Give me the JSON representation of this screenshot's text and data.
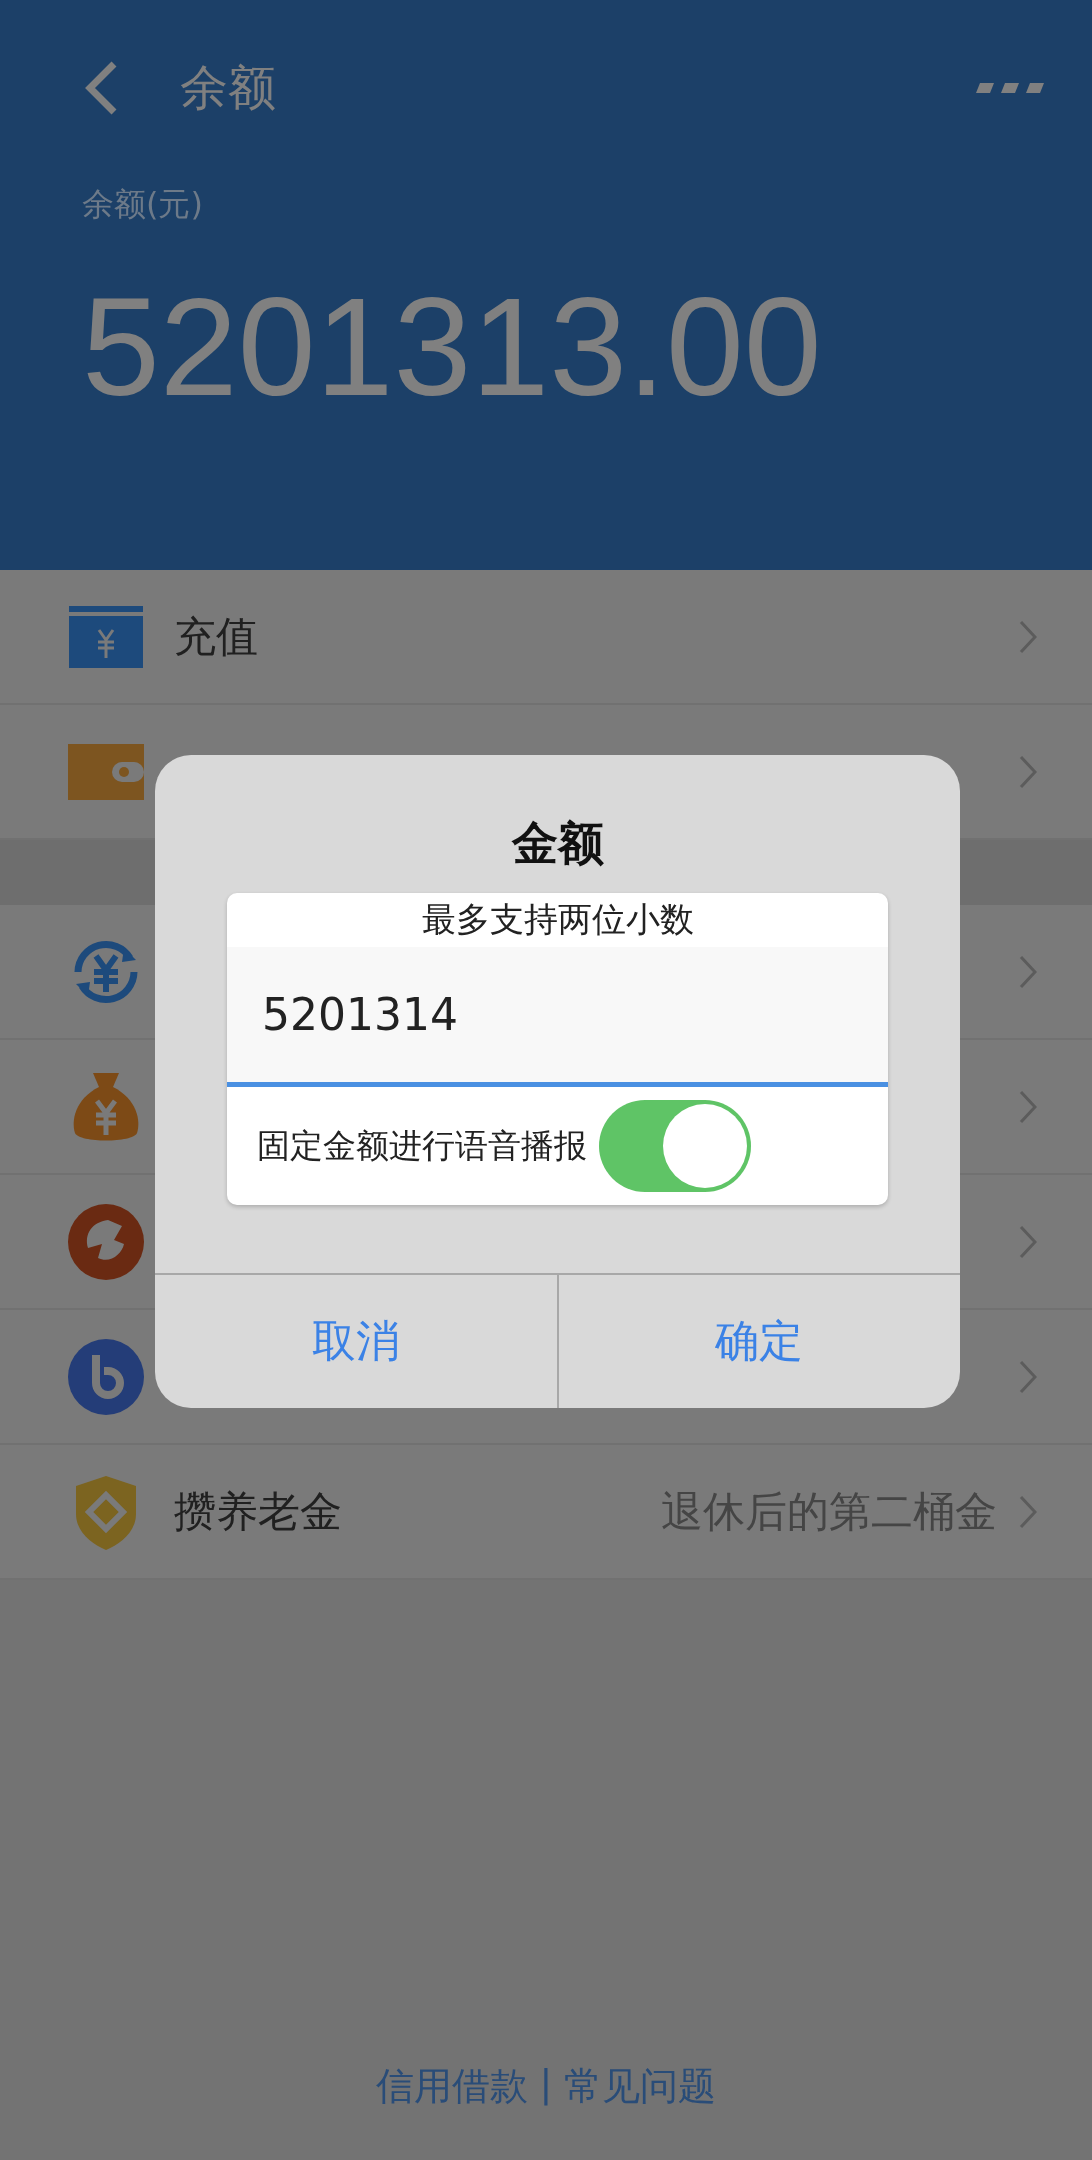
{
  "header": {
    "title": "余额",
    "balance_label": "余额(元)",
    "balance": "5201313.00"
  },
  "menu_groups": [
    {
      "rows": [
        {
          "kind": "card",
          "label": "充值"
        },
        {
          "kind": "wallet"
        }
      ]
    },
    {
      "rows": [
        {
          "kind": "exchange"
        },
        {
          "kind": "bag"
        },
        {
          "kind": "red"
        },
        {
          "kind": "b"
        },
        {
          "kind": "shield",
          "label": "攒养老金",
          "detail": "退休后的第二桶金"
        }
      ]
    }
  ],
  "dialog": {
    "title": "金额",
    "hint": "最多支持两位小数",
    "value": "5201314",
    "toggle": {
      "label": "固定金额进行语音播报",
      "on": true
    },
    "buttons": [
      "取消",
      "确定"
    ]
  },
  "footer": {
    "links": [
      "信用借款",
      "常见问题"
    ],
    "separator": "|"
  }
}
